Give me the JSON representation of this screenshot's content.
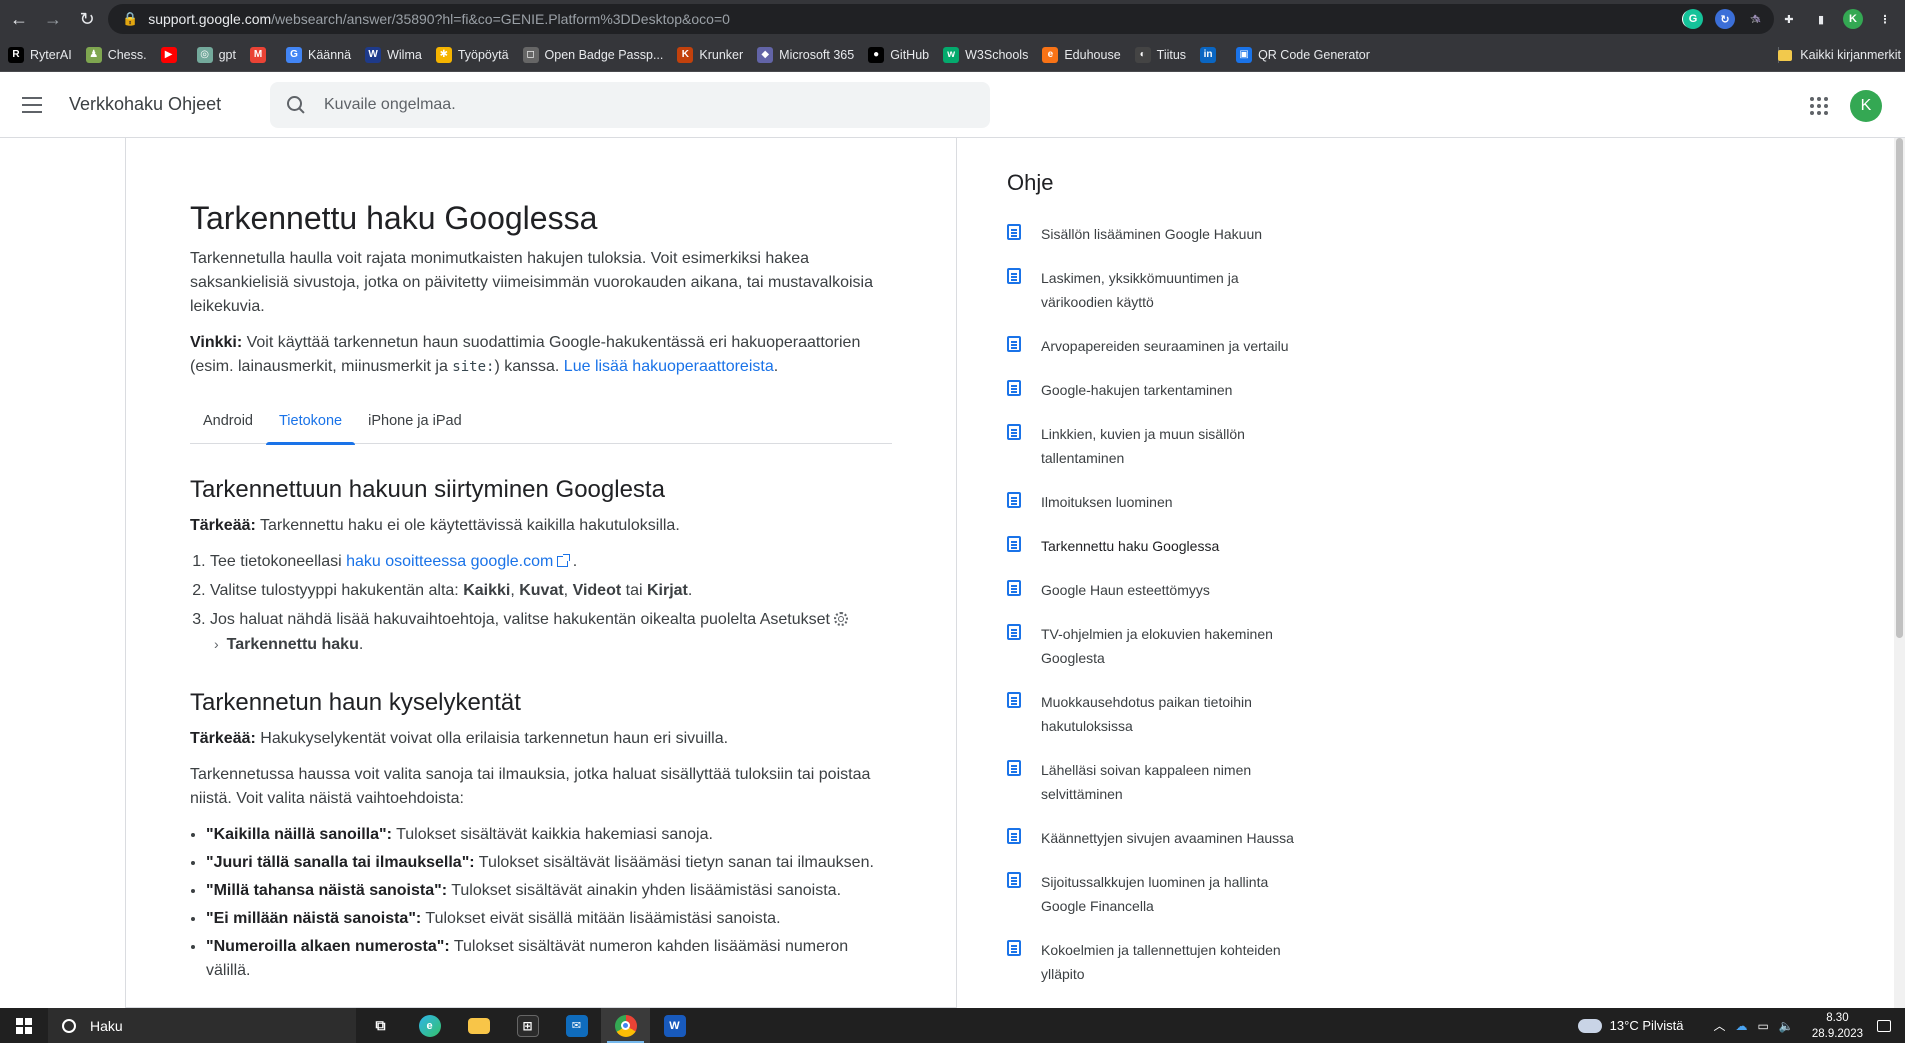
{
  "browser": {
    "url_host": "support.google.com",
    "url_path": "/websearch/answer/35890?hl=fi&co=GENIE.Platform%3DDesktop&oco=0",
    "bookmarks": [
      {
        "label": "RyterAI",
        "icon": "R",
        "color": "#000000"
      },
      {
        "label": "Chess.",
        "icon": "♟",
        "color": "#7fa650"
      },
      {
        "label": "",
        "icon": "▶",
        "color": "#ff0000"
      },
      {
        "label": "gpt",
        "icon": "◎",
        "color": "#74aa9c"
      },
      {
        "label": "",
        "icon": "M",
        "color": "#ea4335"
      },
      {
        "label": "Käännä",
        "icon": "G",
        "color": "#4285f4"
      },
      {
        "label": "Wilma",
        "icon": "W",
        "color": "#1e3a8a"
      },
      {
        "label": "Työpöytä",
        "icon": "✱",
        "color": "#f5b400"
      },
      {
        "label": "Open Badge Passp...",
        "icon": "◻",
        "color": "#666666"
      },
      {
        "label": "Krunker",
        "icon": "K",
        "color": "#c2410c"
      },
      {
        "label": "Microsoft 365",
        "icon": "◆",
        "color": "#6264a7"
      },
      {
        "label": "GitHub",
        "icon": "●",
        "color": "#000000"
      },
      {
        "label": "W3Schools",
        "icon": "w",
        "color": "#04aa6d"
      },
      {
        "label": "Eduhouse",
        "icon": "e",
        "color": "#f97316"
      },
      {
        "label": "Tiitus",
        "icon": "◐",
        "color": "#444444"
      },
      {
        "label": "",
        "icon": "in",
        "color": "#0a66c2"
      },
      {
        "label": "QR Code Generator",
        "icon": "▣",
        "color": "#1a73e8"
      }
    ],
    "all_bookmarks": "Kaikki kirjanmerkit"
  },
  "header": {
    "title": "Verkkohaku Ohjeet",
    "search_placeholder": "Kuvaile ongelmaa.",
    "avatar_letter": "K"
  },
  "article": {
    "title": "Tarkennettu haku Googlessa",
    "intro": "Tarkennetulla haulla voit rajata monimutkaisten hakujen tuloksia. Voit esimerkiksi hakea saksankielisiä sivustoja, jotka on päivitetty viimeisimmän vuorokauden aikana, tai mustavalkoisia leikekuvia.",
    "tip_label": "Vinkki:",
    "tip_text_1": " Voit käyttää tarkennetun haun suodattimia Google-hakukentässä eri hakuoperaattorien (esim. lainausmerkit, miinusmerkit ja ",
    "tip_code": "site:",
    "tip_text_2": ") kanssa. ",
    "tip_link": "Lue lisää hakuoperaattoreista",
    "tip_end": ".",
    "tabs": [
      "Android",
      "Tietokone",
      "iPhone ja iPad"
    ],
    "section1": {
      "heading": "Tarkennettuun hakuun siirtyminen Googlesta",
      "important_label": "Tärkeää:",
      "important_text": " Tarkennettu haku ei ole käytettävissä kaikilla hakutuloksilla.",
      "step1_text": "Tee tietokoneellasi ",
      "step1_link": "haku osoitteessa google.com",
      "step1_end": ".",
      "step2_text": "Valitse tulostyyppi hakukentän alta: ",
      "step2_b1": "Kaikki",
      "step2_b2": "Kuvat",
      "step2_b3": "Videot",
      "step2_or": " tai ",
      "step2_b4": "Kirjat",
      "step3_text": "Jos haluat nähdä lisää hakuvaihtoehtoja, valitse hakukentän oikealta puolelta Asetukset",
      "step3_bold": "Tarkennettu haku"
    },
    "section2": {
      "heading": "Tarkennetun haun kyselykentät",
      "important_label": "Tärkeää:",
      "important_text": " Hakukyselykentät voivat olla erilaisia tarkennetun haun eri sivuilla.",
      "para": "Tarkennetussa haussa voit valita sanoja tai ilmauksia, jotka haluat sisällyttää tuloksiin tai poistaa niistä. Voit valita näistä vaihtoehdoista:",
      "options": [
        {
          "label": "\"Kaikilla näillä sanoilla\":",
          "text": " Tulokset sisältävät kaikkia hakemiasi sanoja."
        },
        {
          "label": "\"Juuri tällä sanalla tai ilmauksella\":",
          "text": " Tulokset sisältävät lisäämäsi tietyn sanan tai ilmauksen."
        },
        {
          "label": "\"Millä tahansa näistä sanoista\":",
          "text": " Tulokset sisältävät ainakin yhden lisäämistäsi sanoista."
        },
        {
          "label": "\"Ei millään näistä sanoista\":",
          "text": " Tulokset eivät sisällä mitään lisäämistäsi sanoista."
        },
        {
          "label": "\"Numeroilla alkaen numerosta\":",
          "text": " Tulokset sisältävät numeron kahden lisäämäsi numeron välillä."
        }
      ]
    }
  },
  "sidebar": {
    "title": "Ohje",
    "items": [
      "Sisällön lisääminen Google Hakuun",
      "Laskimen, yksikkömuuntimen ja värikoodien käyttö",
      "Arvopapereiden seuraaminen ja vertailu",
      "Google-hakujen tarkentaminen",
      "Linkkien, kuvien ja muun sisällön tallentaminen",
      "Ilmoituksen luominen",
      "Tarkennettu haku Googlessa",
      "Google Haun esteettömyys",
      "TV-ohjelmien ja elokuvien hakeminen Googlesta",
      "Muokkausehdotus paikan tietoihin hakutuloksissa",
      "Lähelläsi soivan kappaleen nimen selvittäminen",
      "Käännettyjen sivujen avaaminen Haussa",
      "Sijoitussalkkujen luominen ja hallinta Google Financella",
      "Kokoelmien ja tallennettujen kohteiden ylläpito"
    ]
  },
  "taskbar": {
    "search_label": "Haku",
    "weather": "13°C  Pilvistä",
    "time": "8.30",
    "date": "28.9.2023"
  }
}
